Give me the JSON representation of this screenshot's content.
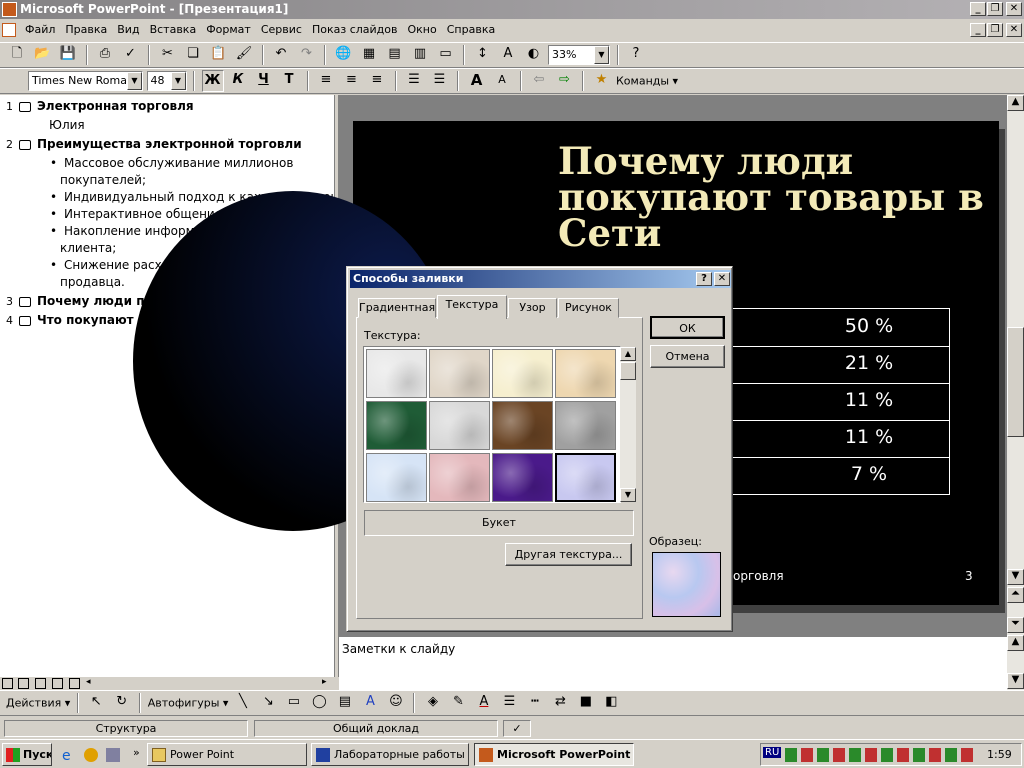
{
  "window": {
    "title": "Microsoft PowerPoint - [Презентация1]"
  },
  "menu": [
    "Файл",
    "Правка",
    "Вид",
    "Вставка",
    "Формат",
    "Сервис",
    "Показ слайдов",
    "Окно",
    "Справка"
  ],
  "toolbar": {
    "zoom": "33%"
  },
  "format_toolbar": {
    "font": "Times New Roman",
    "size": "48",
    "bold": "Ж",
    "italic": "К",
    "underline": "Ч",
    "shadow": "Т",
    "commands": "Команды"
  },
  "outline": {
    "slides": [
      {
        "num": "1",
        "title": "Электронная торговля",
        "sub": [
          "Юлия"
        ]
      },
      {
        "num": "2",
        "title": "Преимущества электронной торговли",
        "bullets": [
          {
            "line1": "Массовое обслуживание миллионов",
            "line2": "покупателей;"
          },
          {
            "line1": "Индивидуальный подход к каждому клиенту;"
          },
          {
            "line1": "Интерактивное общение с покупателем;"
          },
          {
            "line1": "Накопление информации о предпочтениях",
            "line2": "клиента;"
          },
          {
            "line1": "Снижение расходов покупателя и издержек",
            "line2": "продавца."
          }
        ]
      },
      {
        "num": "3",
        "title": "Почему люди покупают товары в Сети"
      },
      {
        "num": "4",
        "title": "Что покупают в Сети"
      }
    ]
  },
  "slide": {
    "title_lines": [
      "Почему люди",
      "покупают товары в",
      "Сети"
    ],
    "values": [
      "50 %",
      "21 %",
      "11 %",
      "11 %",
      "7 %"
    ],
    "footer_left": "орговля",
    "footer_num": "3"
  },
  "notes": {
    "placeholder": "Заметки к слайду"
  },
  "dialog": {
    "title": "Способы заливки",
    "help": "?",
    "close": "✕",
    "tabs": [
      "Градиентная",
      "Текстура",
      "Узор",
      "Рисунок"
    ],
    "active_tab": "Текстура",
    "texture_label": "Текстура:",
    "textures": [
      {
        "name": "tex-white-paper",
        "color": "#e8e8e8"
      },
      {
        "name": "tex-beige",
        "color": "#e0d6c8"
      },
      {
        "name": "tex-cream",
        "color": "#f6efcf"
      },
      {
        "name": "tex-peach",
        "color": "#eed7b0"
      },
      {
        "name": "tex-green-marble",
        "color": "#1f5c36"
      },
      {
        "name": "tex-white-marble",
        "color": "#d8d8d8"
      },
      {
        "name": "tex-brown-wood",
        "color": "#6a4424"
      },
      {
        "name": "tex-granite",
        "color": "#a0a0a0"
      },
      {
        "name": "tex-light-blue",
        "color": "#d6e4f6"
      },
      {
        "name": "tex-pink",
        "color": "#e4b8bc"
      },
      {
        "name": "tex-purple",
        "color": "#4a1a8a"
      },
      {
        "name": "tex-bouquet",
        "color": "#c8c8f0"
      }
    ],
    "selected_texture_name": "Букет",
    "other_texture": "Другая текстура...",
    "ok": "ОК",
    "cancel": "Отмена",
    "sample_label": "Образец:"
  },
  "status": {
    "outline": "Структура",
    "design": "Общий доклад"
  },
  "draw": {
    "actions": "Действия",
    "autoshapes": "Автофигуры"
  },
  "taskbar": {
    "start": "Пуск",
    "items": [
      "Power Point",
      "Лабораторные работы ...",
      "Microsoft PowerPoint ..."
    ],
    "lang": "RU",
    "clock": "1:59"
  }
}
